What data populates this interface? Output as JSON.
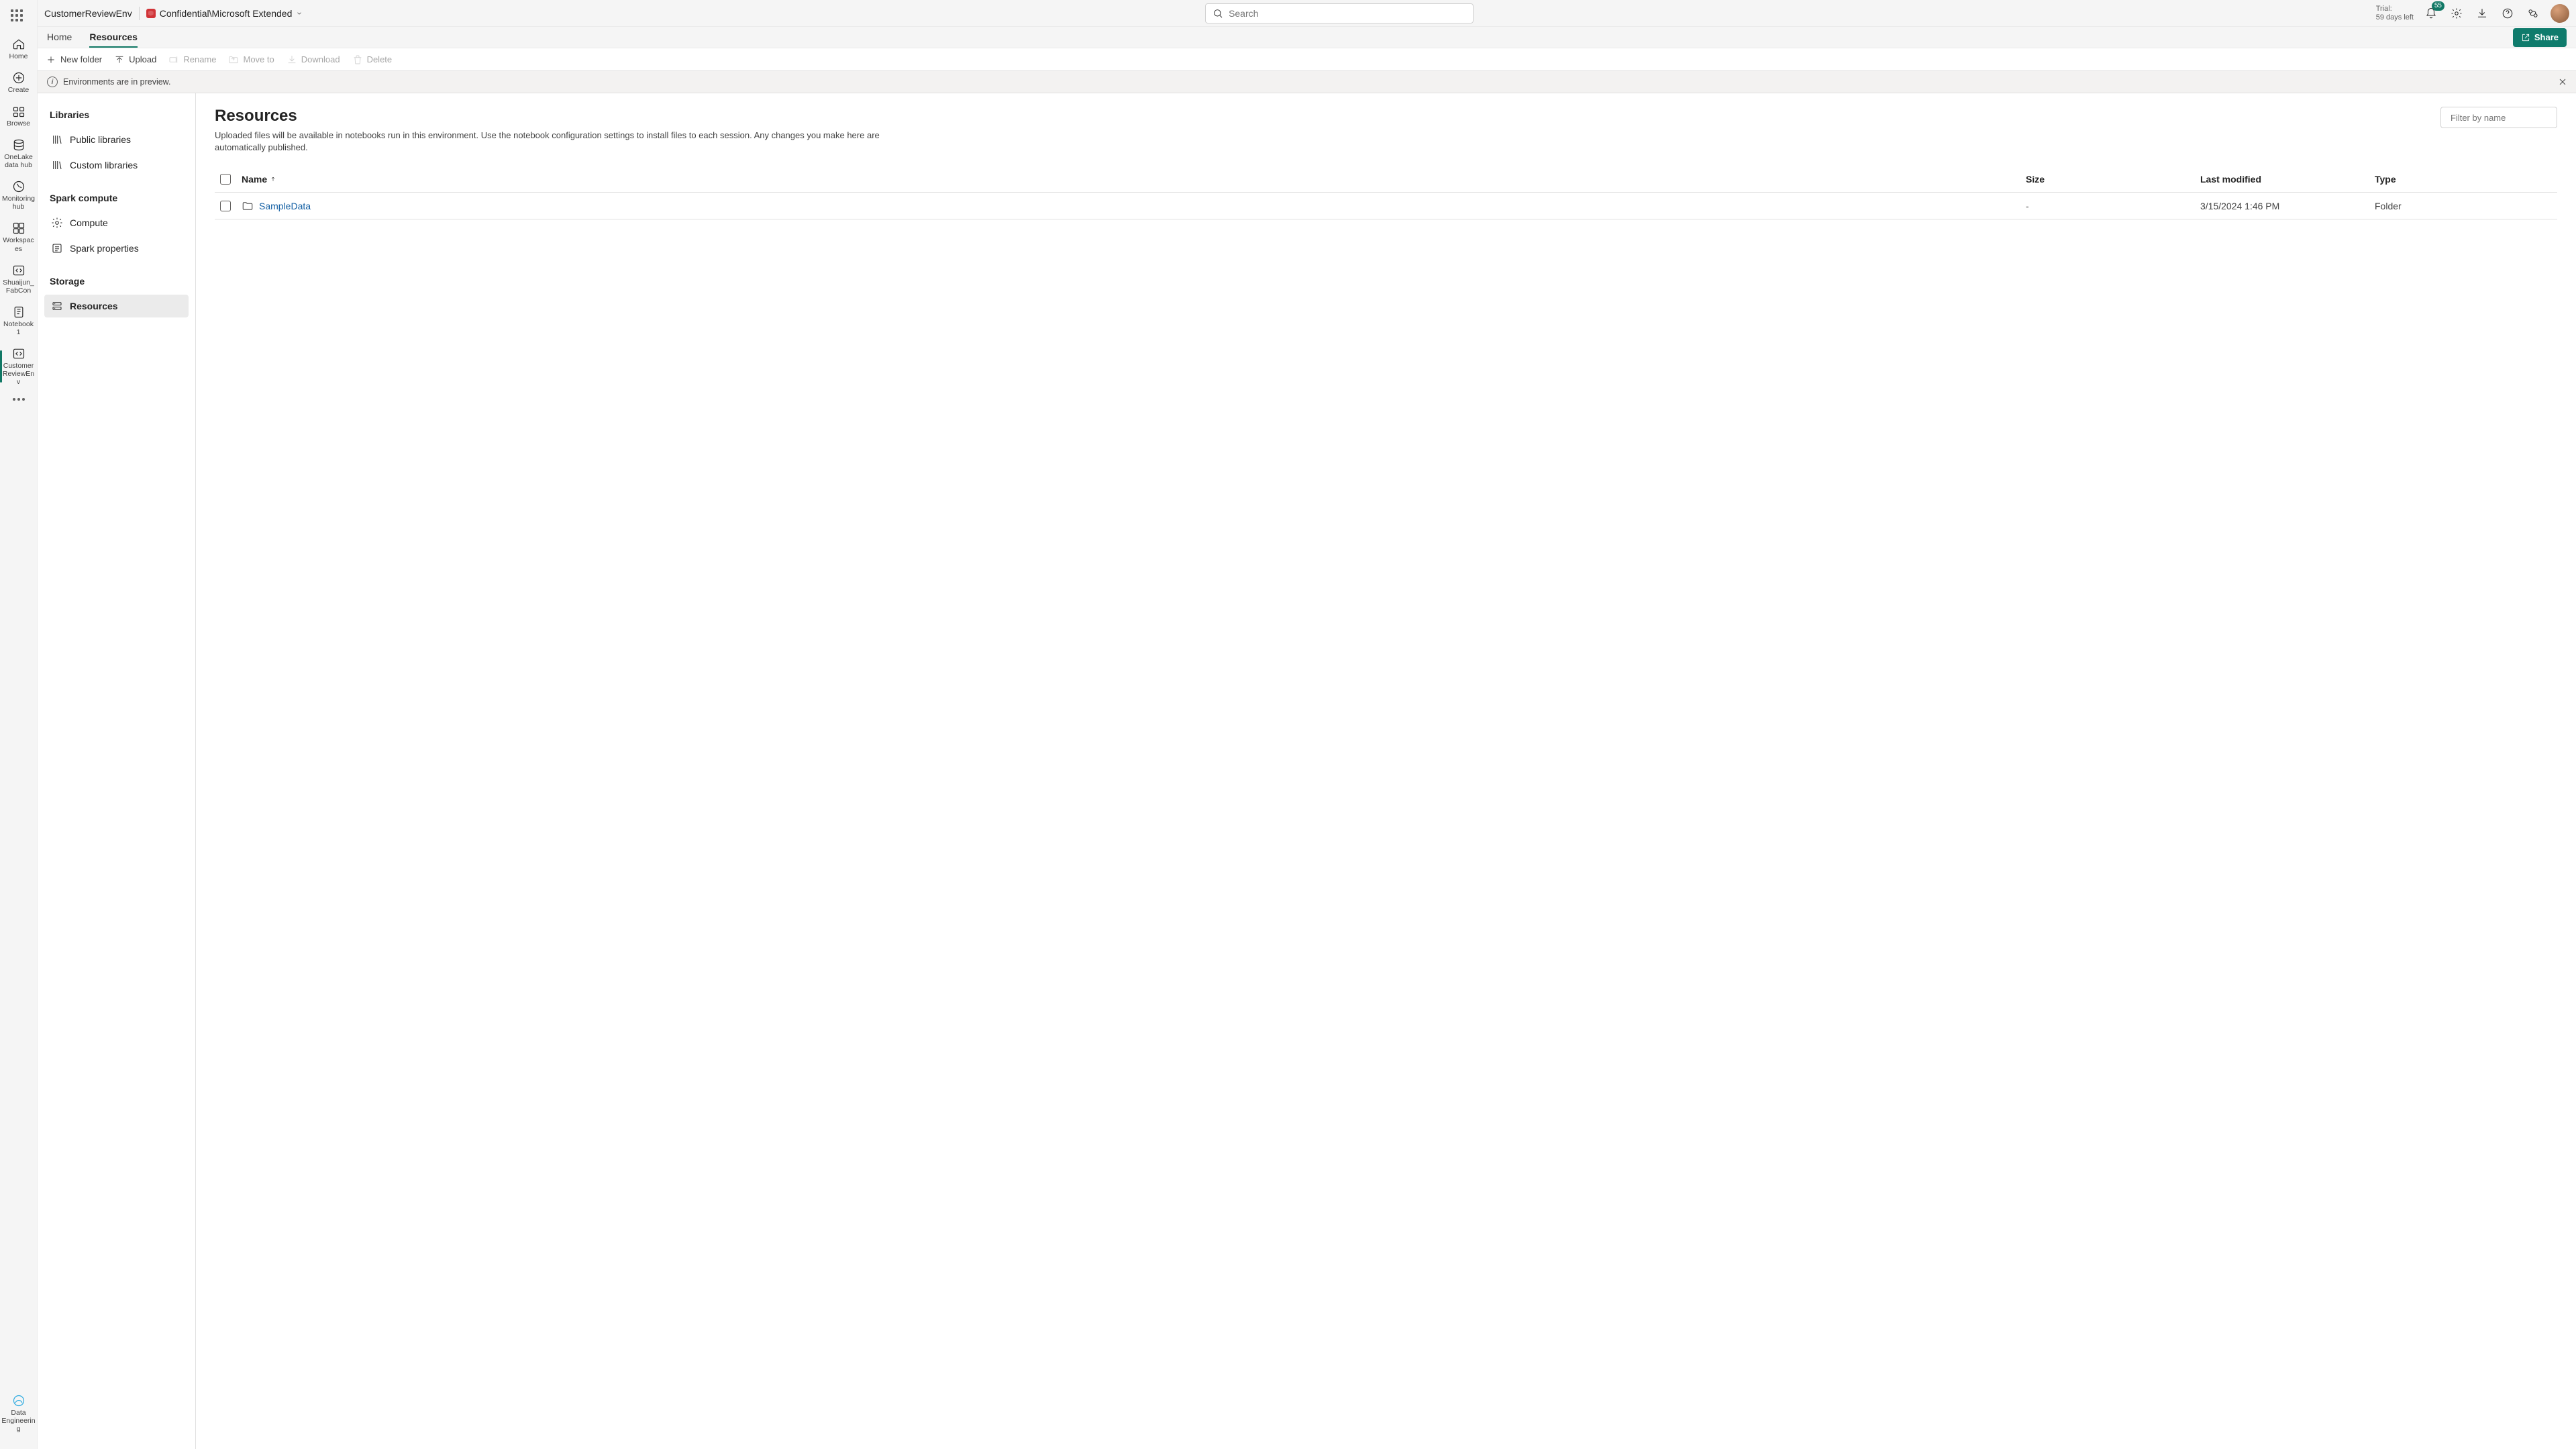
{
  "topbar": {
    "env_name": "CustomerReviewEnv",
    "sensitivity": "Confidential\\Microsoft Extended",
    "search_placeholder": "Search",
    "trial_label": "Trial:",
    "trial_remaining": "59 days left",
    "notif_count": "55"
  },
  "tabs": {
    "home": "Home",
    "resources": "Resources",
    "share": "Share"
  },
  "toolbar": {
    "new_folder": "New folder",
    "upload": "Upload",
    "rename": "Rename",
    "move": "Move to",
    "download": "Download",
    "delete": "Delete"
  },
  "banner": {
    "text": "Environments are in preview."
  },
  "rail": {
    "home": "Home",
    "create": "Create",
    "browse": "Browse",
    "onelake": "OneLake data hub",
    "monitoring": "Monitoring hub",
    "workspaces": "Workspaces",
    "item_notebook_ws": "Shuaijun_FabCon",
    "item_notebook": "Notebook 1",
    "item_env": "CustomerReviewEnv",
    "persona": "Data Engineering"
  },
  "sidebar": {
    "sec_libraries": "Libraries",
    "public_libraries": "Public libraries",
    "custom_libraries": "Custom libraries",
    "sec_spark": "Spark compute",
    "compute": "Compute",
    "spark_props": "Spark properties",
    "sec_storage": "Storage",
    "resources": "Resources"
  },
  "content": {
    "title": "Resources",
    "desc": "Uploaded files will be available in notebooks run in this environment. Use the notebook configuration settings to install files to each session. Any changes you make here are automatically published.",
    "filter_placeholder": "Filter by name",
    "cols": {
      "name": "Name",
      "size": "Size",
      "modified": "Last modified",
      "type": "Type"
    },
    "rows": [
      {
        "name": "SampleData",
        "size": "-",
        "modified": "3/15/2024 1:46 PM",
        "type": "Folder"
      }
    ]
  }
}
